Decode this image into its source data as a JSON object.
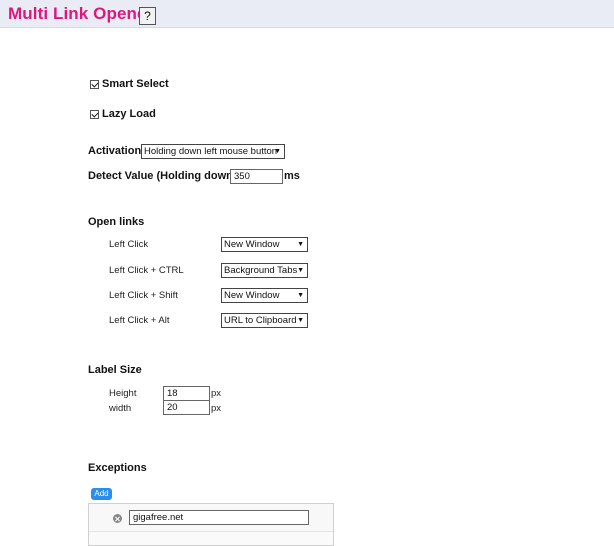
{
  "header": {
    "title": "Multi Link Opener",
    "help_label": "?"
  },
  "options": {
    "smart_select": {
      "label": "Smart Select",
      "checked": true
    },
    "lazy_load": {
      "label": "Lazy Load",
      "checked": true
    },
    "activation": {
      "label": "Activation",
      "value": "Holding down left mouse button"
    },
    "detect_value": {
      "label": "Detect Value (Holding down)",
      "value": "350",
      "unit": "ms"
    }
  },
  "open_links": {
    "heading": "Open links",
    "rows": [
      {
        "label": "Left Click",
        "value": "New Window"
      },
      {
        "label": "Left Click + CTRL",
        "value": "Background Tabs"
      },
      {
        "label": "Left Click + Shift",
        "value": "New Window"
      },
      {
        "label": "Left Click + Alt",
        "value": "URL to Clipboard"
      }
    ]
  },
  "label_size": {
    "heading": "Label Size",
    "height": {
      "label": "Height",
      "value": "18",
      "unit": "px"
    },
    "width": {
      "label": "width",
      "value": "20",
      "unit": "px"
    }
  },
  "exceptions": {
    "heading": "Exceptions",
    "add_label": "Add",
    "items": [
      {
        "value": "gigafree.net"
      }
    ]
  }
}
